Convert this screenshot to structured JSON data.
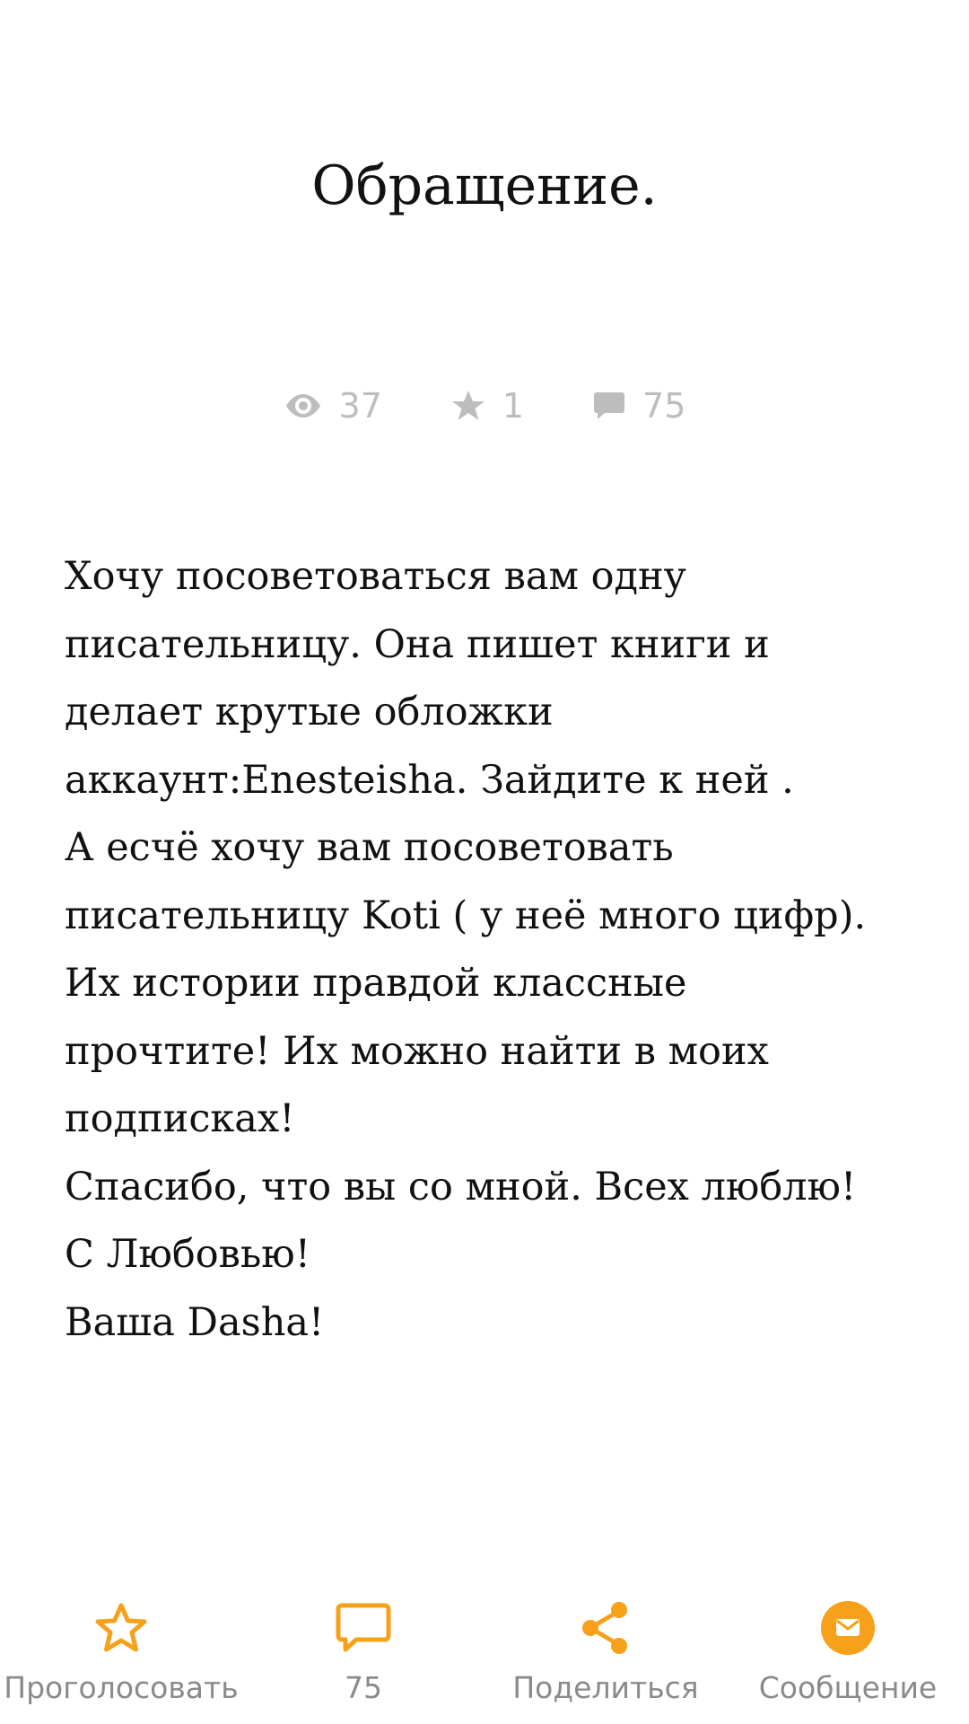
{
  "story": {
    "title": "Обращение.",
    "stats": {
      "views": "37",
      "votes": "1",
      "comments": "75"
    },
    "paragraphs": [
      "Хочу посоветоваться вам одну писательницу. Она пишет книги и делает крутые обложки аккаунт:Enesteisha. Зайдите к ней .",
      "А есчё хочу вам посоветовать писательницу Koti ( у неё много цифр). Их истории правдой классные прочтите! Их можно найти в моих подписках!",
      "Спасибо, что вы со мной. Всех люблю!",
      "С Любовью!",
      "Ваша Dasha!"
    ]
  },
  "actions": {
    "vote_label": "Проголосовать",
    "comments_count": "75",
    "share_label": "Поделиться",
    "message_label": "Сообщение"
  },
  "colors": {
    "accent": "#f7a11b",
    "stat_gray": "#bdbdbd",
    "label_gray": "#8a8a8a"
  },
  "icons": {
    "views": "eye-icon",
    "votes": "star-icon",
    "comments": "comment-icon",
    "vote_action": "star-outline-icon",
    "comment_action": "comment-outline-icon",
    "share_action": "share-icon",
    "message_action": "mail-circle-icon"
  }
}
